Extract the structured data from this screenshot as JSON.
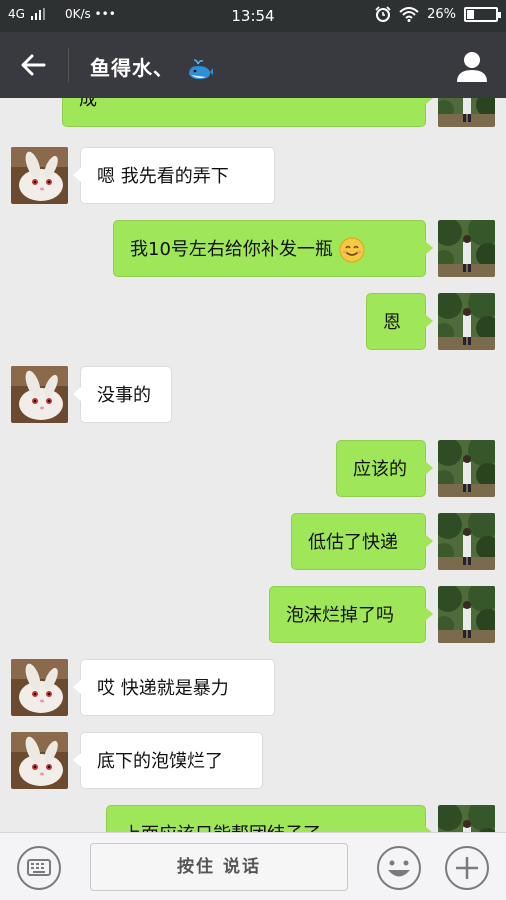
{
  "status_bar": {
    "network": "4G",
    "speed": "0K/s •••",
    "time": "13:54",
    "battery_text": "26%",
    "battery_level": 0.26
  },
  "title_bar": {
    "title": "鱼得水、"
  },
  "messages": [
    {
      "side": "out",
      "text": "成",
      "avatar": "profile-photo"
    },
    {
      "side": "in",
      "text": "嗯  我先看的弄下",
      "avatar": "rabbit-photo"
    },
    {
      "side": "out",
      "text": "我10号左右给你补发一瓶",
      "avatar": "profile-photo",
      "emoji": "smile-emoji"
    },
    {
      "side": "out",
      "text": "恩",
      "avatar": "profile-photo"
    },
    {
      "side": "in",
      "text": "没事的",
      "avatar": "rabbit-photo"
    },
    {
      "side": "out",
      "text": "应该的",
      "avatar": "profile-photo"
    },
    {
      "side": "out",
      "text": "低估了快递",
      "avatar": "profile-photo"
    },
    {
      "side": "out",
      "text": "泡沫烂掉了吗",
      "avatar": "profile-photo"
    },
    {
      "side": "in",
      "text": "哎  快递就是暴力",
      "avatar": "rabbit-photo"
    },
    {
      "side": "in",
      "text": "底下的泡馍烂了",
      "avatar": "rabbit-photo"
    },
    {
      "side": "out",
      "text": "上面应该只能帮团结子了",
      "avatar": "profile-photo"
    }
  ],
  "input_bar": {
    "talk_label": "按住 说话"
  }
}
